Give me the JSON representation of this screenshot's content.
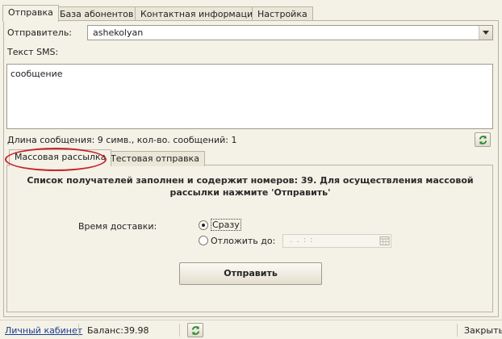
{
  "tabs": [
    {
      "label": "Отправка"
    },
    {
      "label": "База абонентов"
    },
    {
      "label": "Контактная информация"
    },
    {
      "label": "Настройка"
    }
  ],
  "sender": {
    "label": "Отправитель:",
    "value": "ashekolyan"
  },
  "sms": {
    "label": "Текст SMS:",
    "text": "сообщение"
  },
  "message_length": "Длина сообщения: 9 симв., кол-во. сообщений: 1",
  "inner_tabs": [
    {
      "label": "Массовая рассылка"
    },
    {
      "label": "Тестовая отправка"
    }
  ],
  "notice": "Список получателей заполнен и содержит номеров: 39. Для осуществления массовой рассылки нажмите 'Отправить'",
  "delivery": {
    "label": "Время доставки:",
    "option_now": "Сразу",
    "option_delay": "Отложить до:",
    "selected": "now",
    "date_placeholder": ".  .      :  :"
  },
  "send_button": "Отправить",
  "status": {
    "account_link": "Личный кабинет",
    "balance_label": "Баланс:",
    "balance_value": "39.98",
    "close": "Закрыть"
  },
  "colors": {
    "accent_red": "#c8232b",
    "refresh_green": "#2e8b2e",
    "link": "#1a3f8f"
  }
}
